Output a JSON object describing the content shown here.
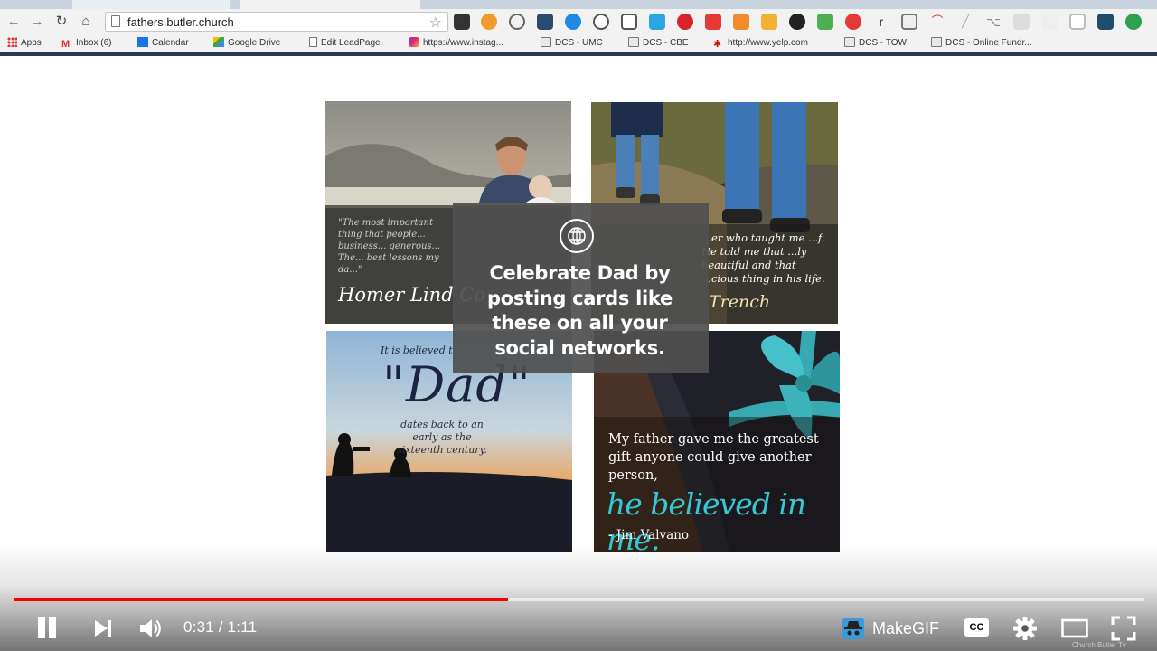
{
  "browser": {
    "url": "fathers.butler.church",
    "bookmarks": [
      {
        "label": "Apps"
      },
      {
        "label": "Inbox (6)"
      },
      {
        "label": "Calendar"
      },
      {
        "label": "Google Drive"
      },
      {
        "label": "Edit LeadPage"
      },
      {
        "label": "https://www.instag..."
      },
      {
        "label": "DCS - UMC"
      },
      {
        "label": "DCS - CBE"
      },
      {
        "label": "http://www.yelp.com"
      },
      {
        "label": "DCS - TOW"
      },
      {
        "label": "DCS - Online Fundr..."
      }
    ]
  },
  "cards": {
    "card1": {
      "quote": "\"The most important thing that people... business... generous... The... best lessons my da...\"",
      "signature": "Homer Lind Co"
    },
    "card2": {
      "quote": "...er who taught me ...f. He told me that ...ly beautiful and that ...cious thing in his life.",
      "signature": "Trench"
    },
    "card3": {
      "lead": "It is believed t",
      "big": "\"Dad\"",
      "sub": "dates back to an early as the sixteenth century."
    },
    "card4": {
      "quote": "My father gave me the greatest gift anyone could give another person,",
      "script": "he believed in me.",
      "signature": "- Jim Valvano"
    }
  },
  "overlay": {
    "icon": "globe-icon",
    "message": "Celebrate Dad by posting cards like these on all your social networks."
  },
  "player": {
    "current_time": "0:31",
    "duration": "1:11",
    "time_display": "0:31 / 1:11",
    "played_fraction": 0.4366,
    "buffered_fraction": 1.0,
    "makegif_label": "MakeGIF",
    "cc_label": "CC",
    "watermark": "Church Butler Tv",
    "accent_color": "#ff0000"
  }
}
